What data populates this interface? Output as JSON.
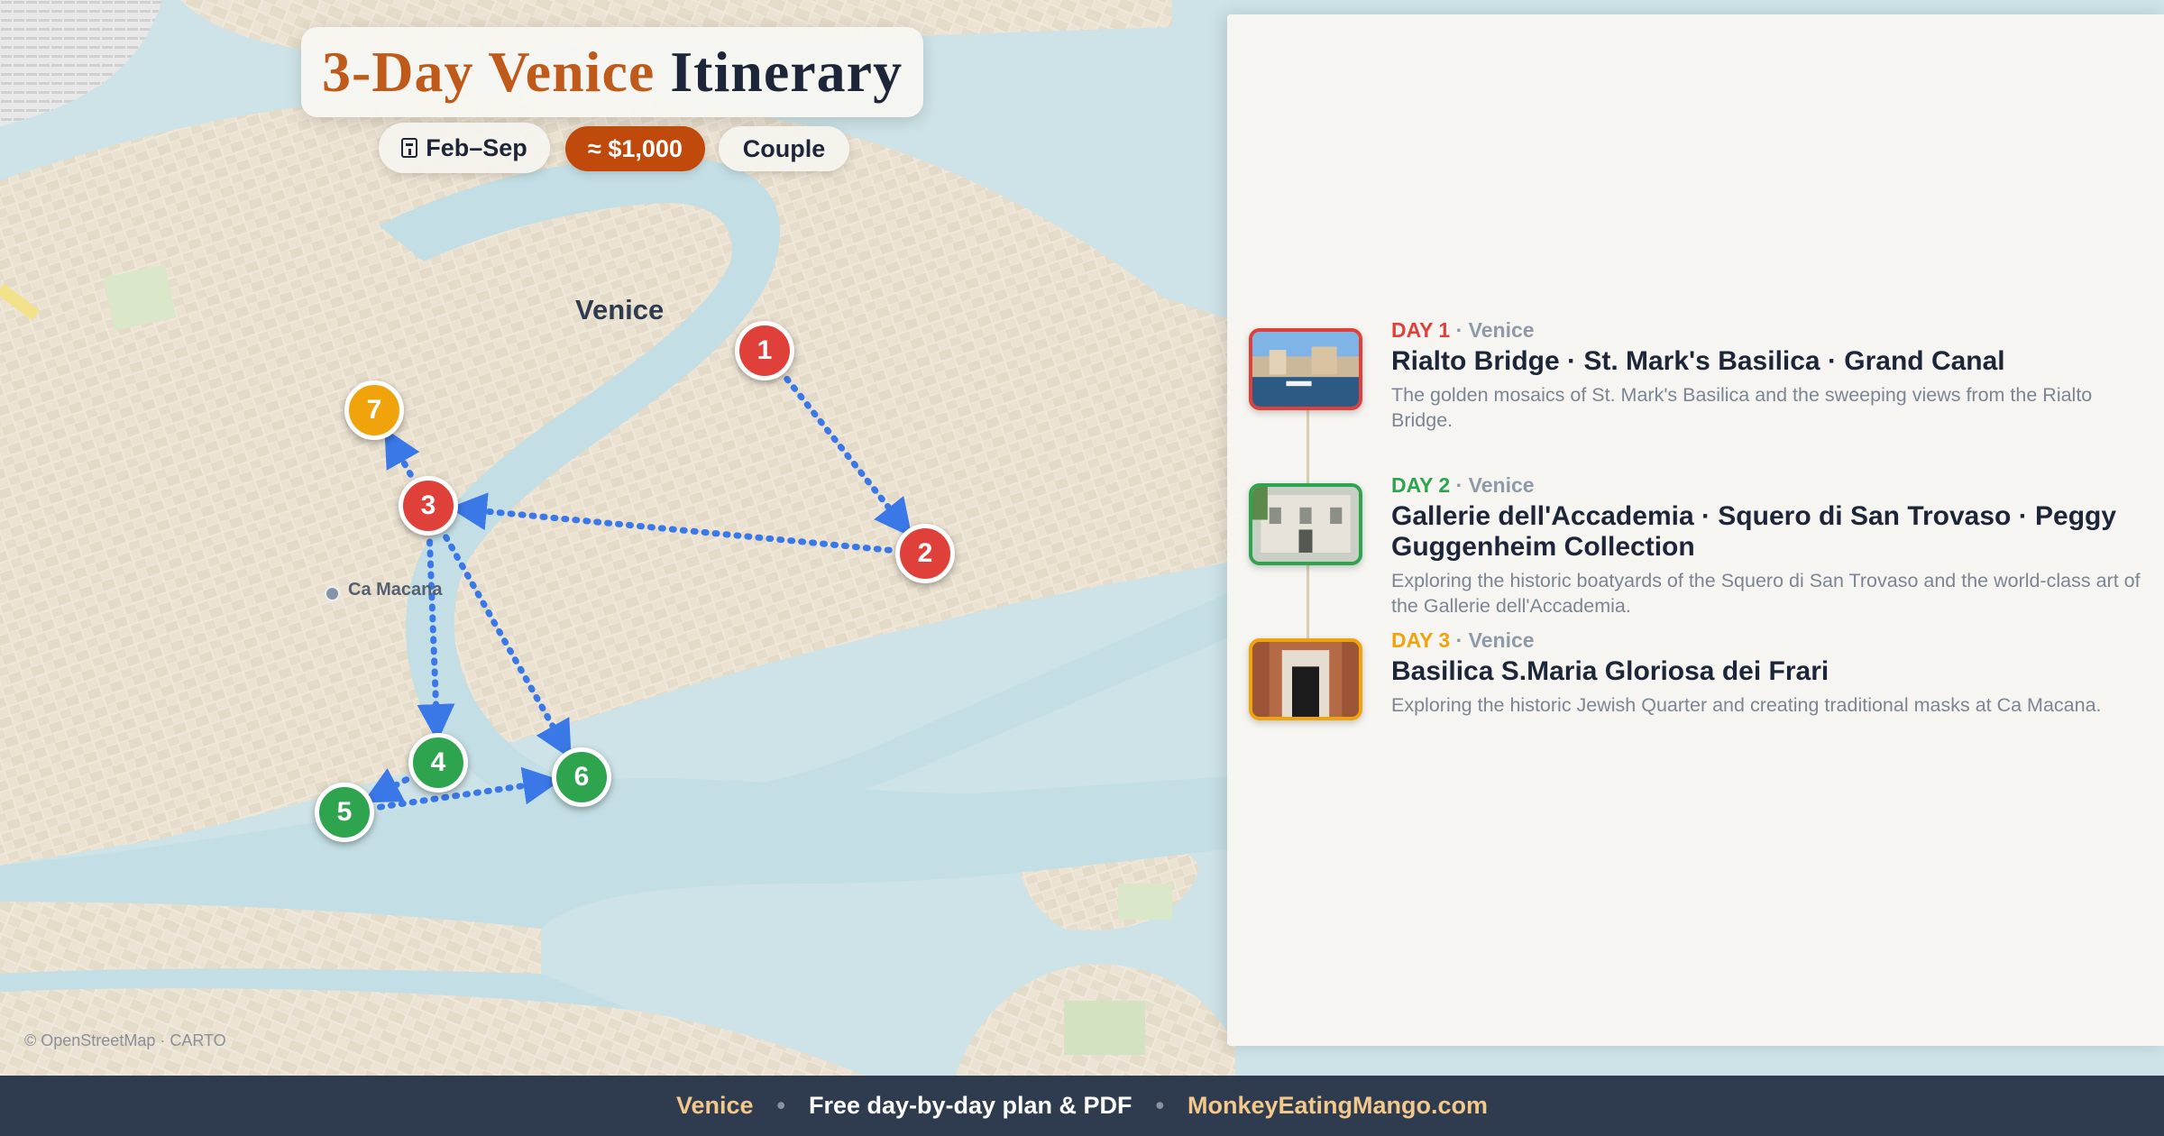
{
  "title": {
    "part1": "3-Day Venice",
    "part2": "Itinerary"
  },
  "chips": {
    "season": "Feb–Sep",
    "budget": "≈ $1,000",
    "travelers": "Couple"
  },
  "icons": {
    "season_icon": "calendar-icon"
  },
  "map": {
    "city_label": "Venice",
    "poi_label": "Ca Macana",
    "attribution": "© OpenStreetMap · CARTO",
    "markers": [
      {
        "n": "1",
        "day": 1
      },
      {
        "n": "2",
        "day": 1
      },
      {
        "n": "3",
        "day": 1
      },
      {
        "n": "4",
        "day": 2
      },
      {
        "n": "5",
        "day": 2
      },
      {
        "n": "6",
        "day": 2
      },
      {
        "n": "7",
        "day": 3
      }
    ]
  },
  "colors": {
    "day1": "#e0403a",
    "day2": "#2ea44f",
    "day3": "#f0a30a",
    "route": "#3b78e7",
    "accent": "#c04a0c"
  },
  "days": [
    {
      "label": "DAY 1",
      "location": "Venice",
      "title": "Rialto Bridge · St. Mark's Basilica · Grand Canal",
      "description": "The golden mosaics of St. Mark's Basilica and the sweeping views from the Rialto Bridge."
    },
    {
      "label": "DAY 2",
      "location": "Venice",
      "title": "Gallerie dell'Accademia · Squero di San Trovaso · Peggy Guggenheim Collection",
      "description": "Exploring the historic boatyards of the Squero di San Trovaso and the world-class art of the Gallerie dell'Accademia."
    },
    {
      "label": "DAY 3",
      "location": "Venice",
      "title": "Basilica S.Maria Gloriosa dei Frari",
      "description": "Exploring the historic Jewish Quarter and creating traditional masks at Ca Macana."
    }
  ],
  "footer": {
    "city": "Venice",
    "tagline": "Free day-by-day plan & PDF",
    "site": "MonkeyEatingMango.com"
  }
}
